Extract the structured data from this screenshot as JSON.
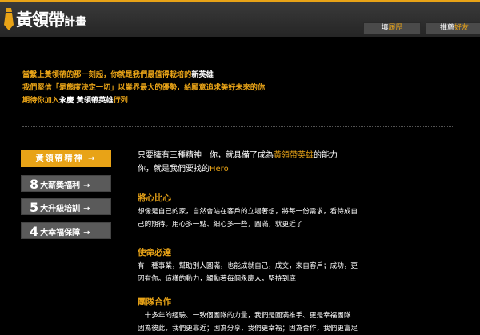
{
  "header": {
    "logo_main": "黃領帶",
    "logo_sub": "計畫",
    "btn_fill_pre": "填",
    "btn_fill_hl": "履歷",
    "btn_recommend_pre": "推薦",
    "btn_recommend_hl": "好友"
  },
  "intro": {
    "line1_a": "當繫上黃領帶的那一刻起，你就是我們最值得栽培的",
    "line1_b": "新英雄",
    "line2": "我們堅信「是態度決定一切」以業界最大的優勢，給願意追求美好未來的你",
    "line3_a": "期待你加入",
    "line3_b": "永慶 黃領帶英雄",
    "line3_c": "行列"
  },
  "menu": {
    "item1": "黃領帶精神",
    "item1_arrow": "→",
    "item2_num": "8",
    "item2_label": "大薪獎福利",
    "item3_num": "5",
    "item3_label": "大升級培訓",
    "item4_num": "4",
    "item4_label": "大幸福保障",
    "arrow": "→"
  },
  "lead": {
    "line1_a": "只要擁有三種精神　你，就具備了成為",
    "line1_b": "黃領帶英雄",
    "line1_c": "的能力",
    "line2_a": "你，就是我們要找的",
    "line2_b": "Hero"
  },
  "sections": [
    {
      "title": "將心比心",
      "line1": "想像是自己的家，自然會站在客戶的立場著想，將每一份需求，看待成自",
      "line2": "己的期待。用心多一點、細心多一些，圓滿，就更近了"
    },
    {
      "title": "使命必達",
      "line1": "有一種事業，幫助別人圓滿，也能成就自己，成交，來自客戶；成功，更",
      "line2": "因有你。這樣的動力，觸動著每個永慶人，堅持到底"
    },
    {
      "title": "團隊合作",
      "line1": "二十多年的經驗、一致個團隊的力量，我們是圓滿推手、更是幸福團隊",
      "line2": "因為彼此，我們更靠近；因為分享，我們更幸福；因為合作，我們更富足"
    }
  ],
  "colors": {
    "accent": "#e8a317",
    "menu_gray": "#5a5a5a",
    "bg": "#000000"
  }
}
